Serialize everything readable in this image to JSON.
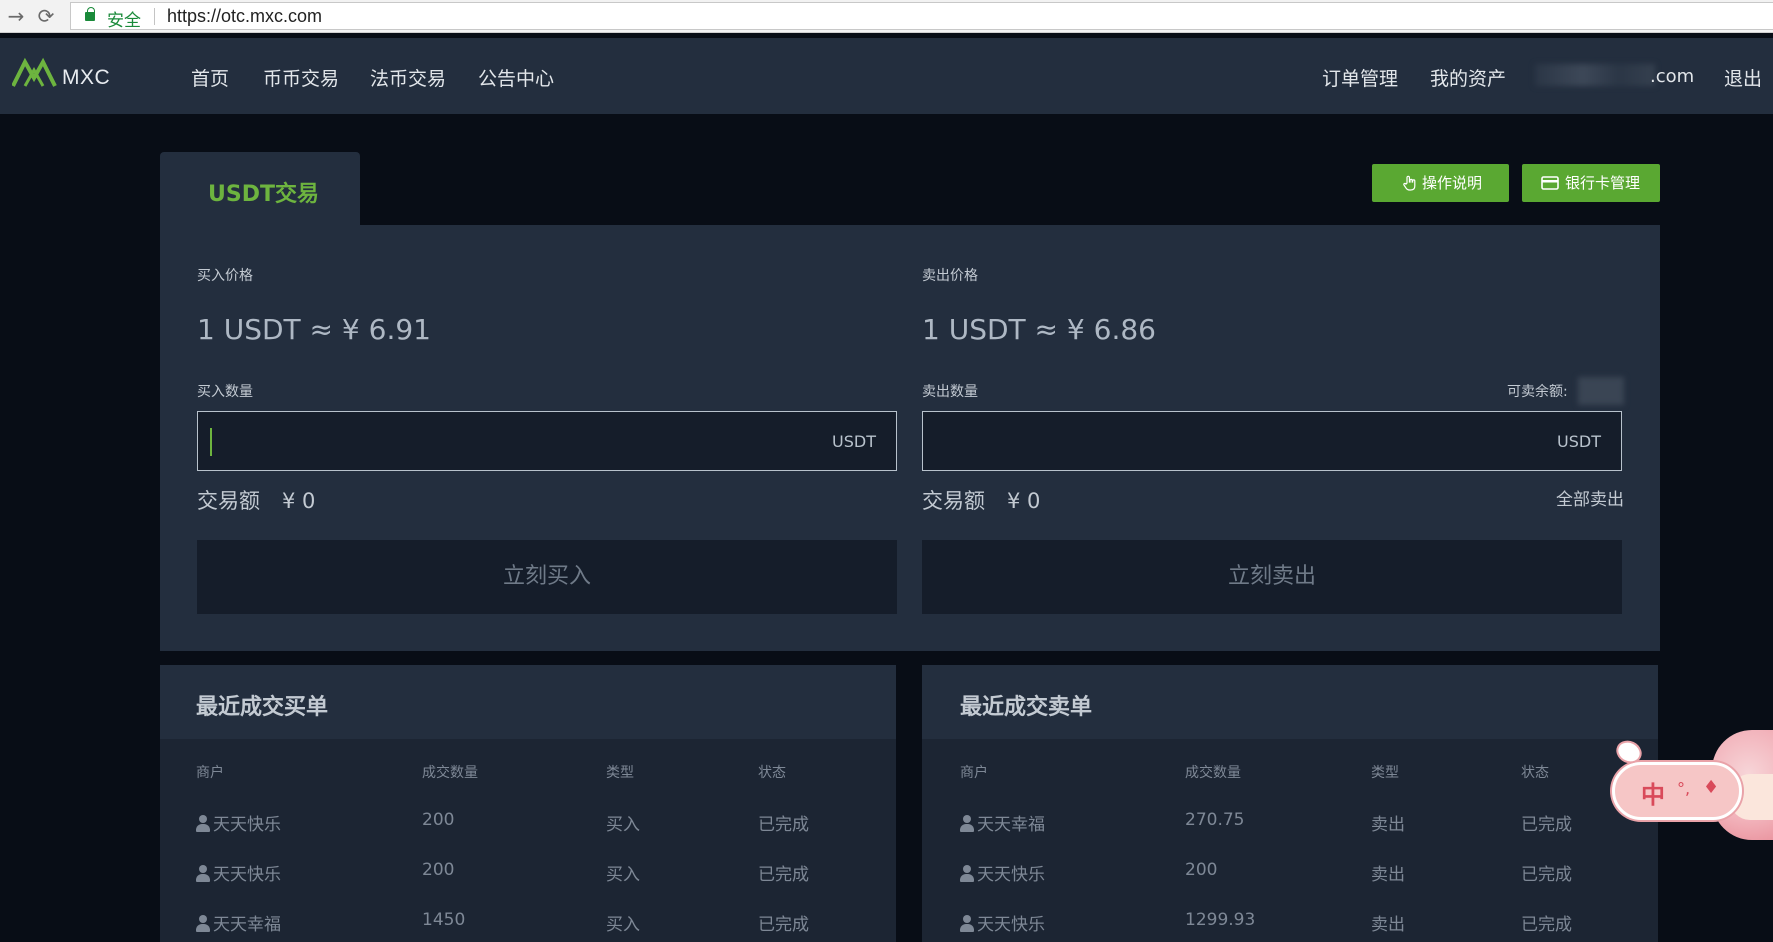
{
  "browser": {
    "back_icon": "arrow-left-icon",
    "reload_icon": "reload-icon",
    "secure_label": "安全",
    "url": "https://otc.mxc.com"
  },
  "header": {
    "logo_text": "MXC",
    "nav": [
      {
        "label": "首页"
      },
      {
        "label": "币币交易"
      },
      {
        "label": "法币交易"
      },
      {
        "label": "公告中心"
      }
    ],
    "right": {
      "orders": "订单管理",
      "assets": "我的资产",
      "email_suffix": ".com",
      "logout": "退出"
    }
  },
  "trade": {
    "tab_label": "USDT交易",
    "help_button": "操作说明",
    "bank_button": "银行卡管理",
    "buy": {
      "price_label": "买入价格",
      "price": "1 USDT ≈ ¥ 6.91",
      "qty_label": "买入数量",
      "unit": "USDT",
      "amount_label": "交易额",
      "amount_value": "¥ 0",
      "action": "立刻买入"
    },
    "sell": {
      "price_label": "卖出价格",
      "price": "1 USDT ≈ ¥ 6.86",
      "qty_label": "卖出数量",
      "balance_label": "可卖余额:",
      "unit": "USDT",
      "amount_label": "交易额",
      "amount_value": "¥ 0",
      "sell_all": "全部卖出",
      "action": "立刻卖出"
    }
  },
  "recent_buy": {
    "title": "最近成交买单",
    "columns": [
      "商户",
      "成交数量",
      "类型",
      "状态"
    ],
    "rows": [
      {
        "merchant": "天天快乐",
        "qty": "200",
        "type": "买入",
        "status": "已完成"
      },
      {
        "merchant": "天天快乐",
        "qty": "200",
        "type": "买入",
        "status": "已完成"
      },
      {
        "merchant": "天天幸福",
        "qty": "1450",
        "type": "买入",
        "status": "已完成"
      }
    ]
  },
  "recent_sell": {
    "title": "最近成交卖单",
    "columns": [
      "商户",
      "成交数量",
      "类型",
      "状态"
    ],
    "rows": [
      {
        "merchant": "天天幸福",
        "qty": "270.75",
        "type": "卖出",
        "status": "已完成"
      },
      {
        "merchant": "天天快乐",
        "qty": "200",
        "type": "卖出",
        "status": "已完成"
      },
      {
        "merchant": "天天快乐",
        "qty": "1299.93",
        "type": "卖出",
        "status": "已完成"
      }
    ]
  },
  "ime": {
    "char": "中",
    "dots": "°,"
  },
  "colors": {
    "accent": "#5aa832",
    "header_bg": "#232e3e",
    "page_bg": "#080d16"
  }
}
